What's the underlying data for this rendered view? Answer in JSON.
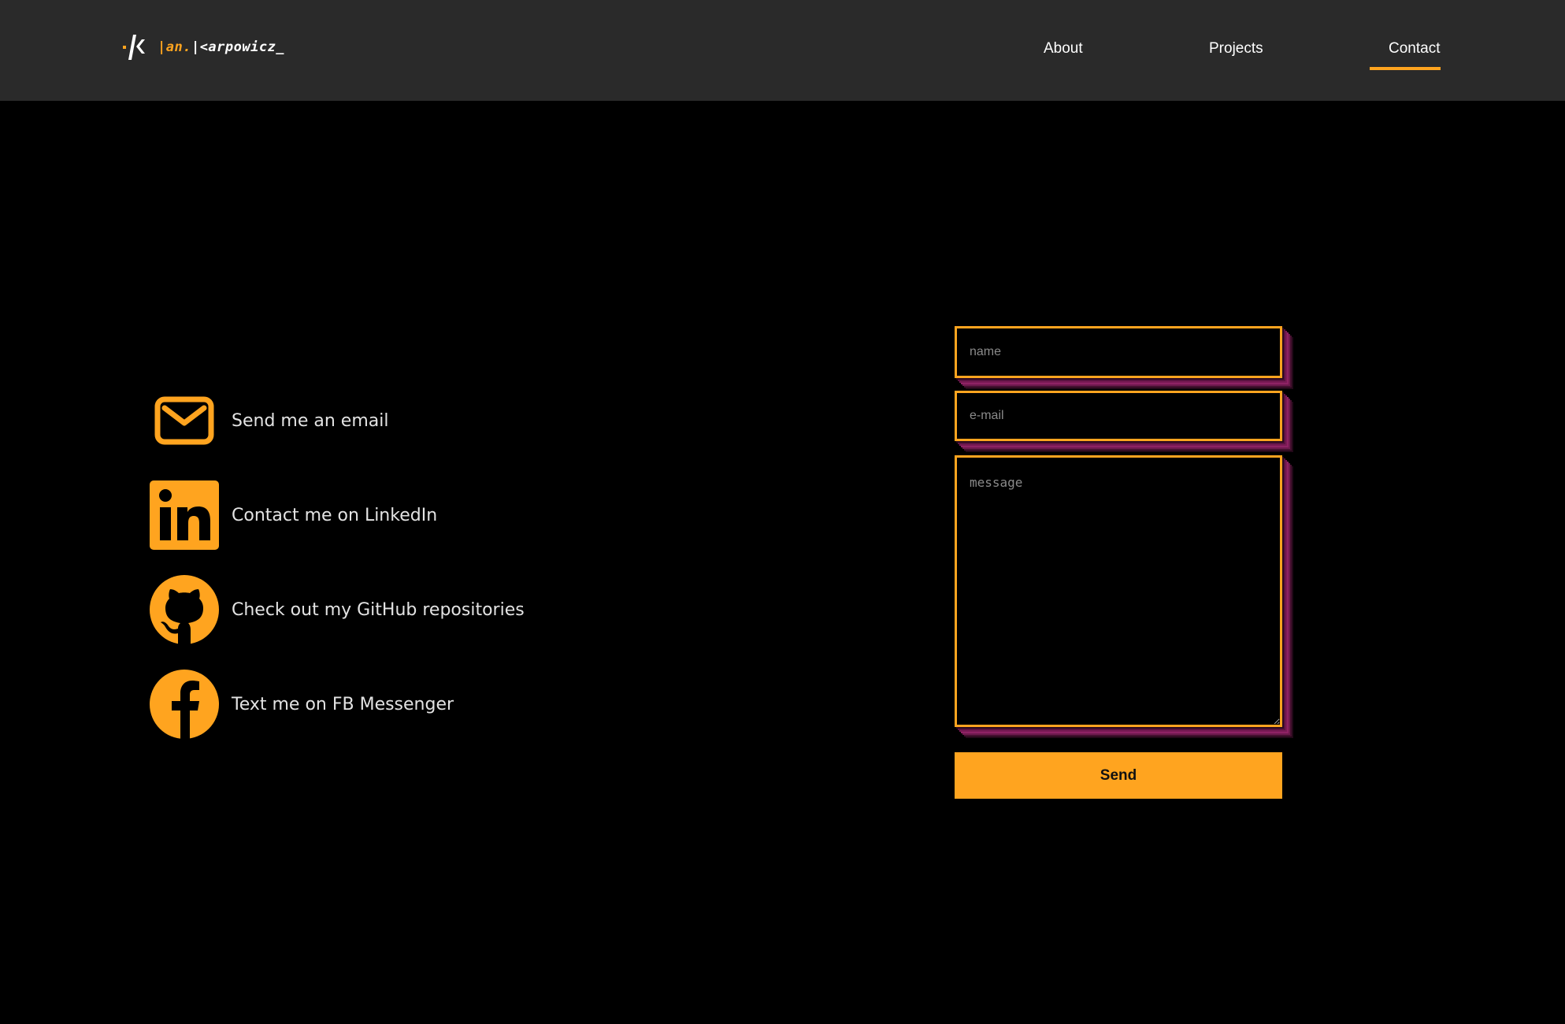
{
  "header": {
    "logo": {
      "text_part_a": "|an.",
      "text_part_b": "|<arpowicz_"
    },
    "nav": {
      "items": [
        {
          "label": "About"
        },
        {
          "label": "Projects"
        },
        {
          "label": "Contact",
          "active": true
        }
      ]
    }
  },
  "contact": {
    "links": [
      {
        "label": "Send me an email",
        "icon": "mail-icon"
      },
      {
        "label": "Contact me on LinkedIn",
        "icon": "linkedin-icon"
      },
      {
        "label": "Check out my GitHub repositories",
        "icon": "github-icon"
      },
      {
        "label": "Text me on FB Messenger",
        "icon": "facebook-icon"
      }
    ]
  },
  "form": {
    "name_placeholder": "name",
    "email_placeholder": "e-mail",
    "message_placeholder": "message",
    "send_label": "Send"
  },
  "colors": {
    "accent": "#ffa41f",
    "header_bg": "#2a2a2a",
    "page_bg": "#000000",
    "shadow": "#8e2264"
  }
}
